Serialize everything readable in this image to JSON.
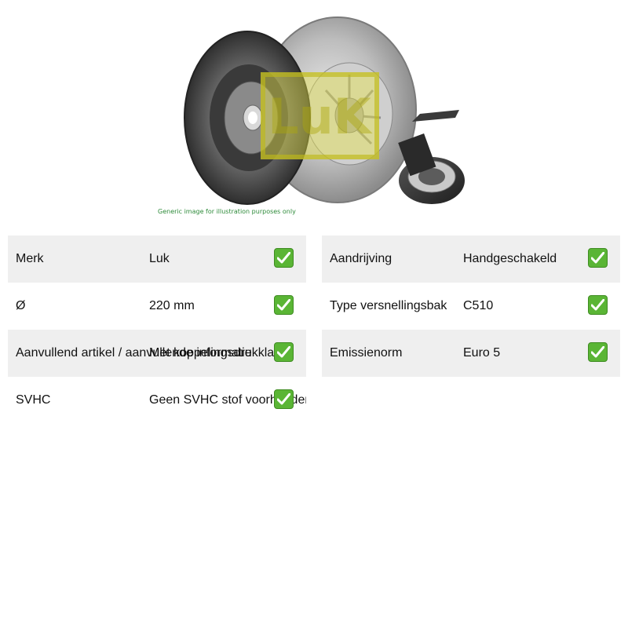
{
  "image": {
    "caption": "Generic image for illustration purposes only",
    "logo_text": "LuK"
  },
  "colors": {
    "row_shade": "#efefef",
    "check_green": "#5ab535",
    "caption_green": "#2e8b3a"
  },
  "spec_left": [
    {
      "label": "Merk",
      "value": "Luk",
      "status_icon": "check-icon"
    },
    {
      "label": "Ø",
      "value": "220 mm",
      "status_icon": "check-icon"
    },
    {
      "label": "Aanvullend artikel / aanvullende informatie",
      "value": "Met koppelingsdrukklager",
      "status_icon": "check-icon"
    },
    {
      "label": "SVHC",
      "value": "Geen SVHC stof voorhanden",
      "status_icon": "check-icon"
    }
  ],
  "spec_right": [
    {
      "label": "Aandrijving",
      "value": "Handgeschakeld",
      "status_icon": "check-icon"
    },
    {
      "label": "Type versnellingsbak",
      "value": "C510",
      "status_icon": "check-icon"
    },
    {
      "label": "Emissienorm",
      "value": "Euro 5",
      "status_icon": "check-icon"
    }
  ]
}
